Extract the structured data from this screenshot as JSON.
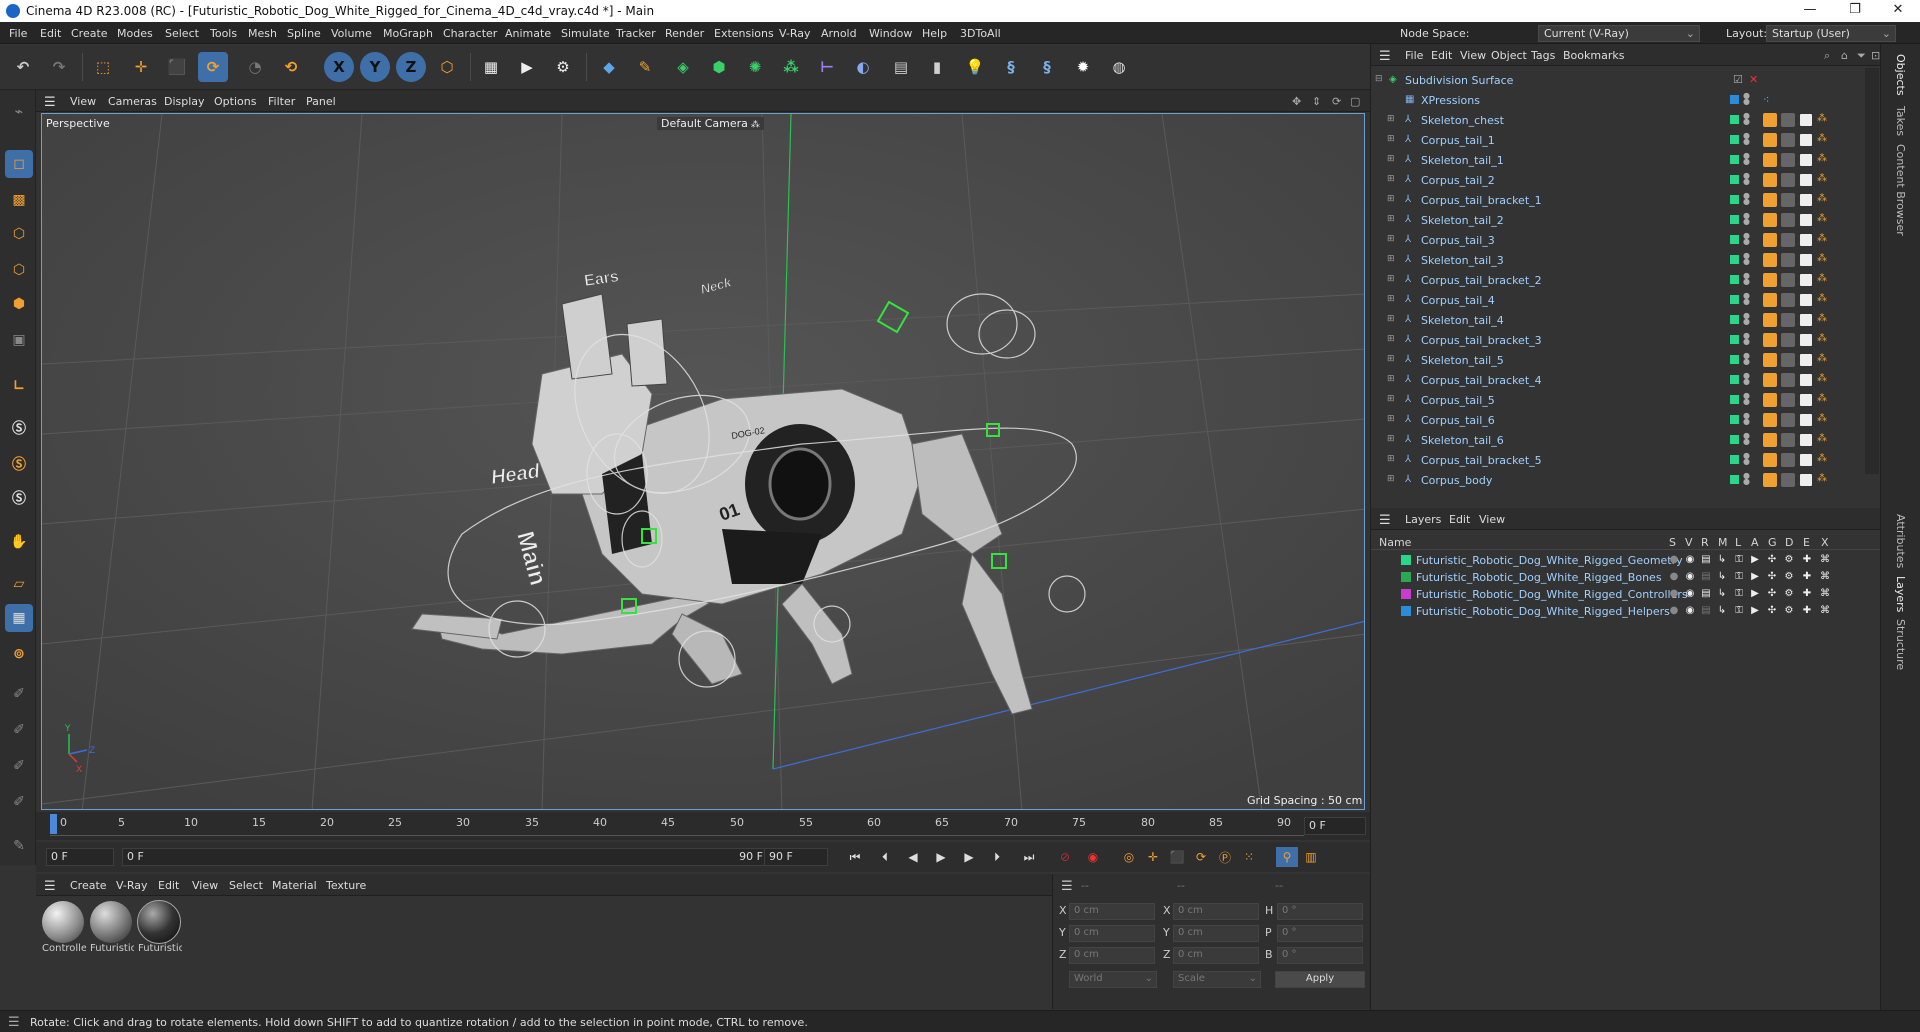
{
  "window": {
    "title": "Cinema 4D R23.008 (RC) - [Futuristic_Robotic_Dog_White_Rigged_for_Cinema_4D_c4d_vray.c4d *] - Main",
    "controls": [
      "—",
      "❐",
      "✕"
    ]
  },
  "menubar": {
    "items": [
      "File",
      "Edit",
      "Create",
      "Modes",
      "Select",
      "Tools",
      "Mesh",
      "Spline",
      "Volume",
      "MoGraph",
      "Character",
      "Animate",
      "Simulate",
      "Tracker",
      "Render",
      "Extensions",
      "V-Ray",
      "Arnold",
      "Window",
      "Help",
      "3DToAll"
    ],
    "node_space_label": "Node Space:",
    "node_space_value": "Current (V-Ray)",
    "layout_label": "Layout:",
    "layout_value": "Startup (User)"
  },
  "toolbar": {
    "axis_x": "X",
    "axis_y": "Y",
    "axis_z": "Z"
  },
  "viewport": {
    "menu": [
      "View",
      "Cameras",
      "Display",
      "Options",
      "Filter",
      "Panel"
    ],
    "label": "Perspective",
    "camera": "Default Camera",
    "grid_spacing": "Grid Spacing : 50 cm",
    "axis_labels": {
      "y": "Y",
      "z": "Z",
      "x": "X"
    },
    "scene_text": [
      "Ears",
      "Neck",
      "Head",
      "Main",
      "DOG-02",
      "01"
    ]
  },
  "timeline": {
    "ticks": [
      "0",
      "5",
      "10",
      "15",
      "20",
      "25",
      "30",
      "35",
      "40",
      "45",
      "50",
      "55",
      "60",
      "65",
      "70",
      "75",
      "80",
      "85",
      "90"
    ],
    "current_frame": "0 F",
    "start_frame": "0 F",
    "range_start": "0 F",
    "range_end": "90 F",
    "end_frame": "90 F"
  },
  "materials": {
    "menu": [
      "Create",
      "V-Ray",
      "Edit",
      "View",
      "Select",
      "Material",
      "Texture"
    ],
    "items": [
      "Controlle",
      "Futuristic",
      "Futuristic"
    ]
  },
  "coordinates": {
    "rows": [
      {
        "a": "X",
        "av": "0 cm",
        "b": "X",
        "bv": "0 cm",
        "c": "H",
        "cv": "0 °"
      },
      {
        "a": "Y",
        "av": "0 cm",
        "b": "Y",
        "bv": "0 cm",
        "c": "P",
        "cv": "0 °"
      },
      {
        "a": "Z",
        "av": "0 cm",
        "b": "Z",
        "bv": "0 cm",
        "c": "B",
        "cv": "0 °"
      }
    ],
    "space": "World",
    "mode": "Scale",
    "apply": "Apply",
    "dashes": [
      "--",
      "--",
      "--"
    ]
  },
  "objects": {
    "menu": [
      "File",
      "Edit",
      "View",
      "Object",
      "Tags",
      "Bookmarks"
    ],
    "rows": [
      {
        "name": "Subdivision Surface",
        "color": "#555555"
      },
      {
        "name": "XPressions",
        "color": "#2b8cdc"
      },
      {
        "name": "Skeleton_chest",
        "color": "#2bd68a"
      },
      {
        "name": "Corpus_tail_1",
        "color": "#2bd68a"
      },
      {
        "name": "Skeleton_tail_1",
        "color": "#2bd68a"
      },
      {
        "name": "Corpus_tail_2",
        "color": "#2bd68a"
      },
      {
        "name": "Corpus_tail_bracket_1",
        "color": "#2bd68a"
      },
      {
        "name": "Skeleton_tail_2",
        "color": "#2bd68a"
      },
      {
        "name": "Corpus_tail_3",
        "color": "#2bd68a"
      },
      {
        "name": "Skeleton_tail_3",
        "color": "#2bd68a"
      },
      {
        "name": "Corpus_tail_bracket_2",
        "color": "#2bd68a"
      },
      {
        "name": "Corpus_tail_4",
        "color": "#2bd68a"
      },
      {
        "name": "Skeleton_tail_4",
        "color": "#2bd68a"
      },
      {
        "name": "Corpus_tail_bracket_3",
        "color": "#2bd68a"
      },
      {
        "name": "Skeleton_tail_5",
        "color": "#2bd68a"
      },
      {
        "name": "Corpus_tail_bracket_4",
        "color": "#2bd68a"
      },
      {
        "name": "Corpus_tail_5",
        "color": "#2bd68a"
      },
      {
        "name": "Corpus_tail_6",
        "color": "#2bd68a"
      },
      {
        "name": "Skeleton_tail_6",
        "color": "#2bd68a"
      },
      {
        "name": "Corpus_tail_bracket_5",
        "color": "#2bd68a"
      },
      {
        "name": "Corpus_body",
        "color": "#2bd68a"
      }
    ]
  },
  "layers": {
    "menu": [
      "Layers",
      "Edit",
      "View"
    ],
    "header": {
      "name": "Name",
      "cols": [
        "S",
        "V",
        "R",
        "M",
        "L",
        "A",
        "G",
        "D",
        "E",
        "X"
      ]
    },
    "rows": [
      {
        "name": "Futuristic_Robotic_Dog_White_Rigged_Geometry",
        "color": "#2bd68a"
      },
      {
        "name": "Futuristic_Robotic_Dog_White_Rigged_Bones",
        "color": "#2aa854"
      },
      {
        "name": "Futuristic_Robotic_Dog_White_Rigged_Controllers",
        "color": "#c83cd0"
      },
      {
        "name": "Futuristic_Robotic_Dog_White_Rigged_Helpers",
        "color": "#2b8cdc"
      }
    ]
  },
  "sidetabs": [
    "Objects",
    "Takes",
    "Content Browser",
    "Attributes",
    "Layers",
    "Structure"
  ],
  "status": {
    "text": "Rotate: Click and drag to rotate elements. Hold down SHIFT to add to quantize rotation / add to the selection in point mode, CTRL to remove."
  }
}
